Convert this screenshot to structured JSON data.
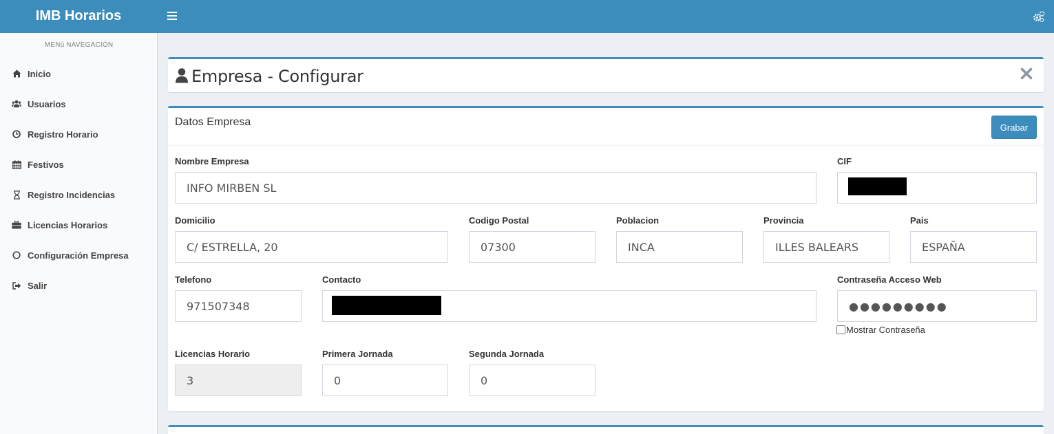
{
  "app": {
    "title": "IMB Horarios"
  },
  "topbar": {
    "menu_icon": "hamburger-icon",
    "settings_icon": "gears-icon"
  },
  "sidebar": {
    "header": "MENú NAVEGACIÓN",
    "items": [
      {
        "label": "Inicio",
        "icon": "home-icon"
      },
      {
        "label": "Usuarios",
        "icon": "users-icon"
      },
      {
        "label": "Registro Horario",
        "icon": "clock-icon"
      },
      {
        "label": "Festivos",
        "icon": "calendar-icon"
      },
      {
        "label": "Registro Incidencias",
        "icon": "hourglass-icon"
      },
      {
        "label": "Licencias Horarios",
        "icon": "briefcase-icon"
      },
      {
        "label": "Configuración Empresa",
        "icon": "circle-icon"
      },
      {
        "label": "Salir",
        "icon": "sign-out-icon"
      }
    ]
  },
  "page": {
    "title": "Empresa - Configurar"
  },
  "form": {
    "section_title": "Datos Empresa",
    "save_label": "Grabar",
    "fields": {
      "nombre": {
        "label": "Nombre Empresa",
        "value": "INFO MIRBEN SL"
      },
      "cif": {
        "label": "CIF"
      },
      "domicilio": {
        "label": "Domicilio",
        "value": "C/ ESTRELLA, 20"
      },
      "cp": {
        "label": "Codigo Postal",
        "value": "07300"
      },
      "poblacion": {
        "label": "Poblacion",
        "value": "INCA"
      },
      "provincia": {
        "label": "Provincia",
        "value": "ILLES BALEARS"
      },
      "pais": {
        "label": "Pais",
        "value": "ESPAÑA"
      },
      "telefono": {
        "label": "Telefono",
        "value": "971507348"
      },
      "contacto": {
        "label": "Contacto"
      },
      "password": {
        "label": "Contraseña Acceso Web",
        "value": "●●●●●●●●●"
      },
      "mostrar": {
        "label": "Mostrar Contraseña"
      },
      "licencias": {
        "label": "Licencias Horario",
        "value": "3"
      },
      "primera": {
        "label": "Primera Jornada",
        "value": "0"
      },
      "segunda": {
        "label": "Segunda Jornada",
        "value": "0"
      }
    }
  },
  "colors": {
    "primary": "#3c8dbc",
    "background": "#ecf0f5",
    "sidebar": "#f9fafc"
  }
}
